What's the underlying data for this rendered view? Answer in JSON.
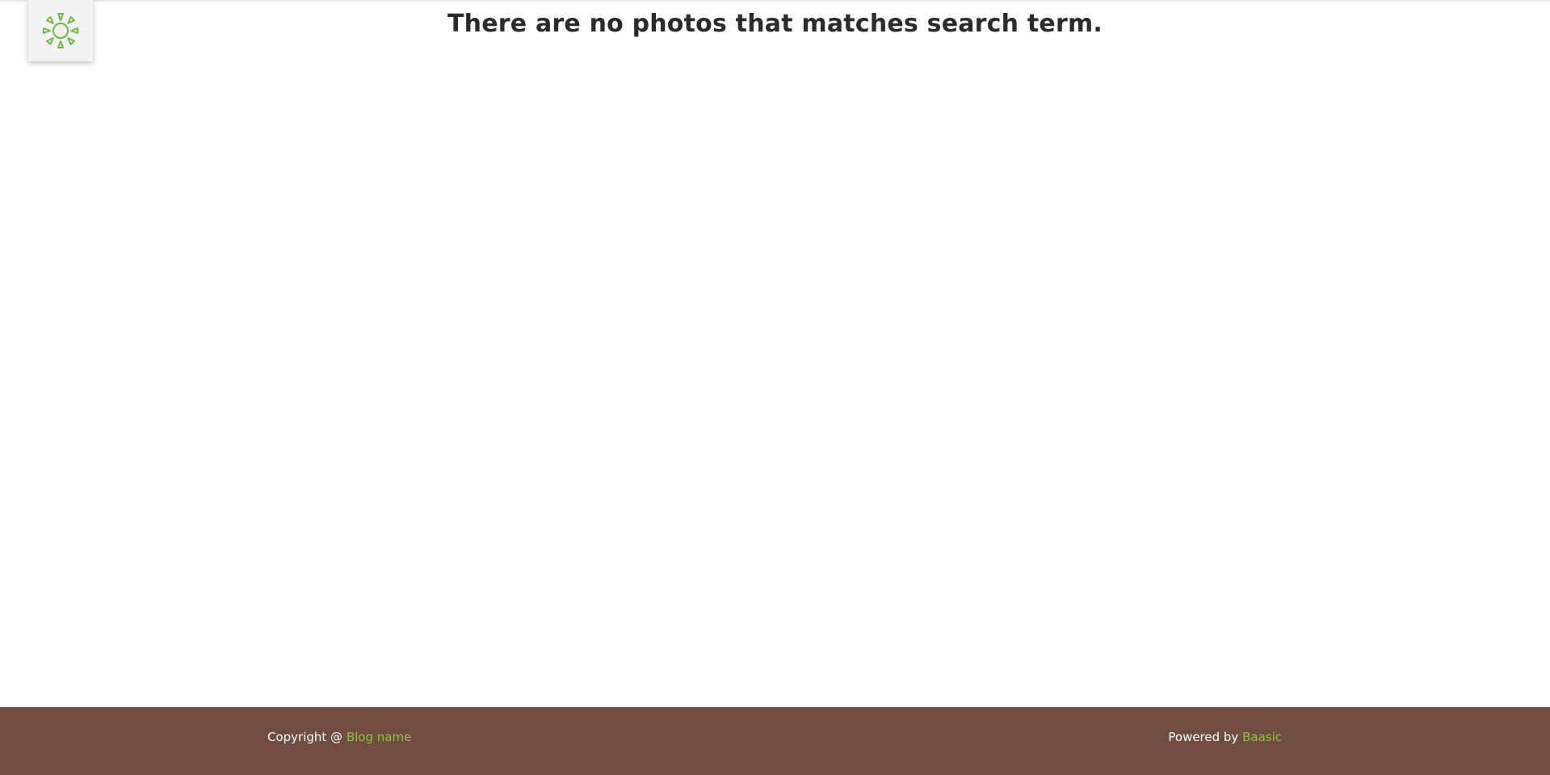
{
  "header": {
    "logo_icon": "sunburst-logo-icon",
    "accent_color": "#6cbb3c"
  },
  "main": {
    "message": "There are no photos that matches search term."
  },
  "footer": {
    "background_color": "#714c40",
    "copyright_prefix": "Copyright @ ",
    "blog_link": "Blog name",
    "powered_prefix": "Powered by ",
    "powered_link": "Baasic",
    "link_color": "#8cc63f"
  }
}
